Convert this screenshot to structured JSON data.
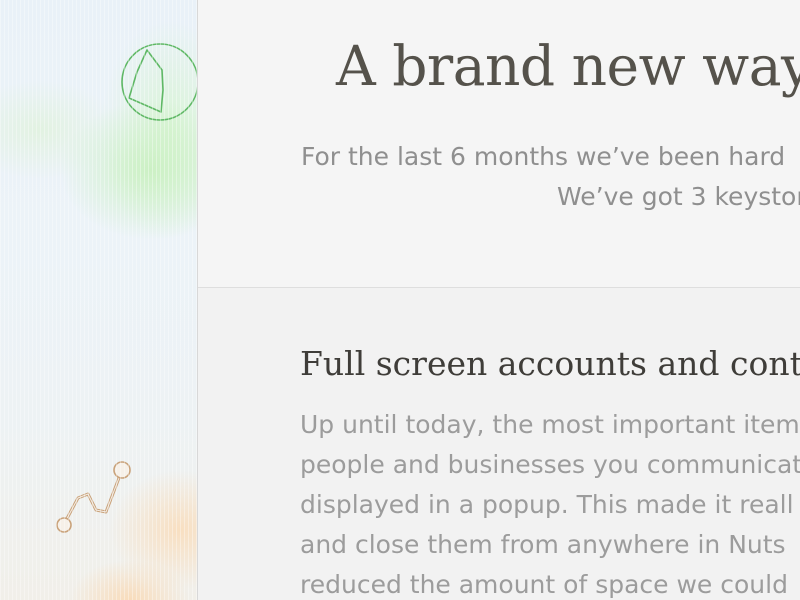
{
  "hero": {
    "title": "A brand new way",
    "subtitle_lines": [
      "For the last 6 months we’ve been hard",
      "We’ve got 3 keystor"
    ]
  },
  "feature": {
    "title": "Full screen accounts and contac",
    "paragraph_lines": [
      "Up until today, the most important item",
      "people and businesses you communicat",
      "displayed in a popup. This made it reall",
      "and close them from anywhere in Nuts",
      "reduced the amount of space we could"
    ]
  },
  "icons": {
    "compass": "compass-icon",
    "path": "path-icon"
  },
  "colors": {
    "heading": "#55524b",
    "body_text": "#9c9c9c",
    "compass_stroke": "#4caf50",
    "path_stroke": "#c9a27a"
  }
}
